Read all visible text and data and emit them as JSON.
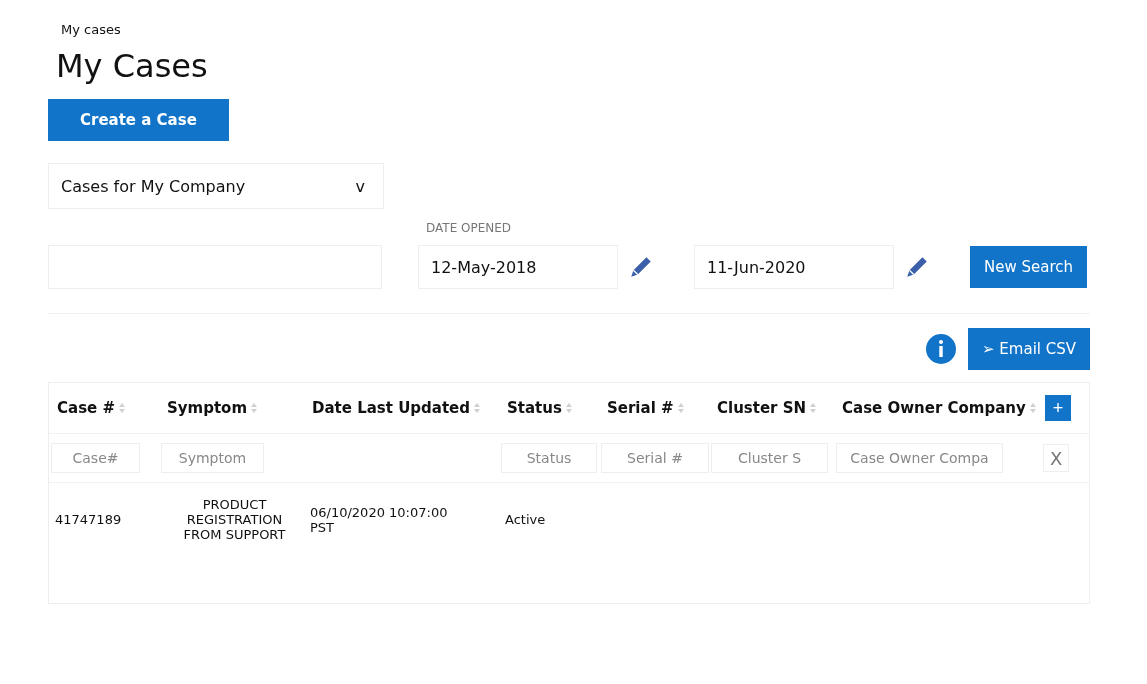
{
  "breadcrumb": "My cases",
  "title": "My Cases",
  "create_button": "Create a Case",
  "case_filter": {
    "value": "Cases for My Company",
    "caret": "v"
  },
  "date_opened": {
    "label": "DATE OPENED",
    "from": "12-May-2018",
    "to": "11-Jun-2020"
  },
  "new_search_button": "New Search",
  "email_csv_button": {
    "icon": "➢",
    "label": "Email CSV"
  },
  "table": {
    "columns": [
      {
        "label": "Case #",
        "filter_placeholder": "Case#"
      },
      {
        "label": "Symptom",
        "filter_placeholder": "Symptom"
      },
      {
        "label": "Date Last Updated"
      },
      {
        "label": "Status",
        "filter_placeholder": "Status"
      },
      {
        "label": "Serial #",
        "filter_placeholder": "Serial #"
      },
      {
        "label": "Cluster SN",
        "filter_placeholder": "Cluster S"
      },
      {
        "label": "Case Owner Company",
        "filter_placeholder": "Case Owner Compa"
      }
    ],
    "add_column_button": "+",
    "clear_filters_button": "X",
    "rows": [
      {
        "cells": [
          "41747189",
          "PRODUCT REGISTRATION FROM SUPPORT",
          "06/10/2020 10:07:00 PST",
          "Active",
          "",
          "",
          ""
        ]
      }
    ]
  }
}
